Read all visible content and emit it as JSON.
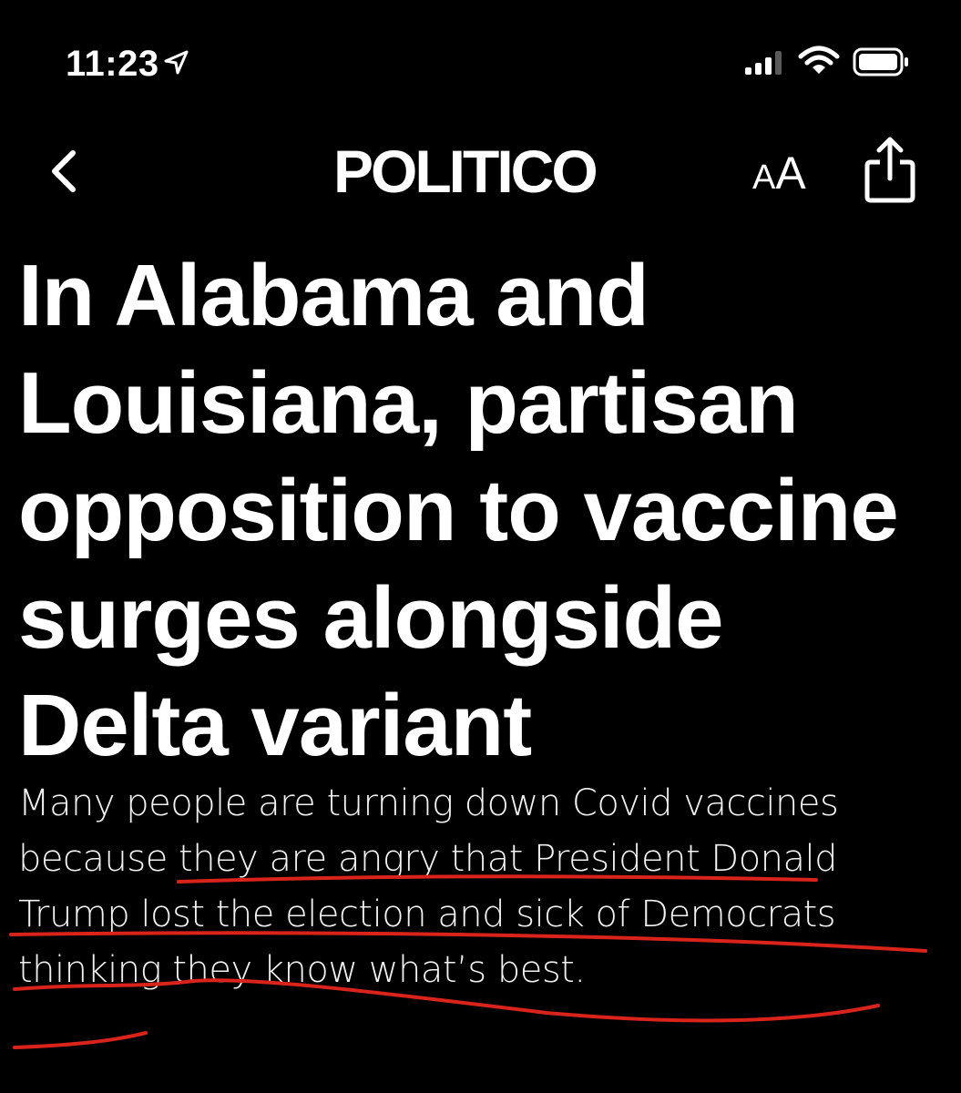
{
  "status_bar": {
    "time": "11:23",
    "location_icon": "location-arrow-icon",
    "signal_icon": "cellular-signal-icon",
    "wifi_icon": "wifi-icon",
    "battery_icon": "battery-icon"
  },
  "nav": {
    "back_icon": "chevron-left-icon",
    "brand": "POLITICO",
    "text_size_small": "A",
    "text_size_large": "A",
    "share_icon": "share-icon"
  },
  "article": {
    "headline": "In Alabama and Louisiana, partisan opposition to vaccine surges alongside Delta variant",
    "dek": "Many people are turning down Covid vaccines because they are angry that President Donald Trump lost the election and sick of Democrats thinking they know what’s best."
  },
  "annotation": {
    "underline_color": "#d9231b"
  }
}
